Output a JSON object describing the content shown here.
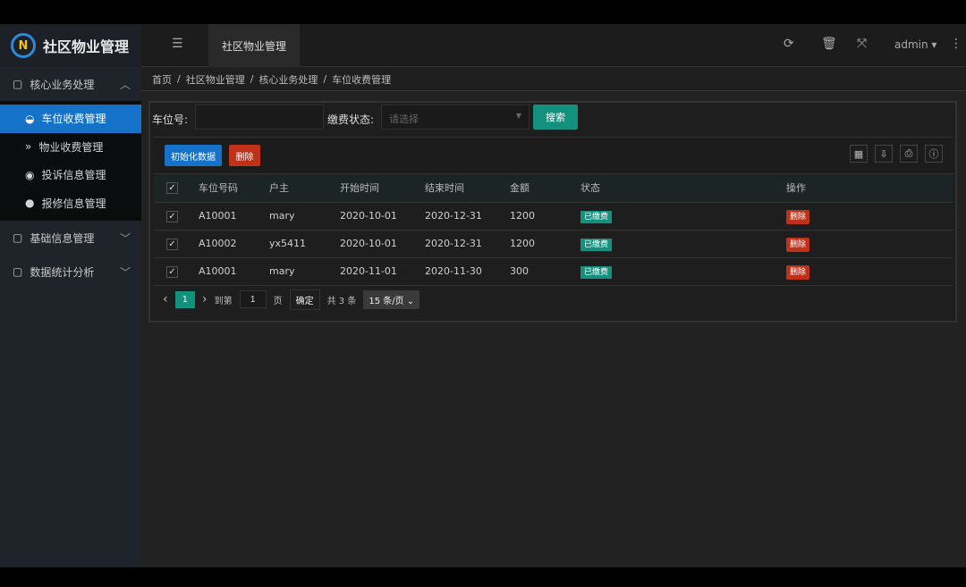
{
  "app": {
    "title": "社区物业管理",
    "logo_letter": "N",
    "tab": "社区物业管理",
    "user": "admin"
  },
  "header_icons": [
    "menu-icon",
    "refresh-icon",
    "trash-icon",
    "fullscreen-icon",
    "more-icon"
  ],
  "sidebar": {
    "groups": [
      {
        "label": "核心业务处理",
        "expanded": true,
        "items": [
          {
            "label": "车位收费管理",
            "active": true,
            "icon": "dashboard-icon"
          },
          {
            "label": "物业收费管理",
            "icon": "chevrons-down-icon"
          },
          {
            "label": "投诉信息管理",
            "icon": "target-icon"
          },
          {
            "label": "报修信息管理",
            "icon": "circle-icon"
          }
        ]
      },
      {
        "label": "基础信息管理",
        "expanded": false
      },
      {
        "label": "数据统计分析",
        "expanded": false
      }
    ]
  },
  "breadcrumb": [
    "首页",
    "社区物业管理",
    "核心业务处理",
    "车位收费管理"
  ],
  "search": {
    "plate_label": "车位号:",
    "plate_value": "",
    "status_label": "缴费状态:",
    "status_placeholder": "请选择",
    "search_button": "搜索"
  },
  "toolbar": {
    "init_button": "初始化数据",
    "delete_button": "删除"
  },
  "table": {
    "headers": [
      "车位号码",
      "户主",
      "开始时间",
      "结束时间",
      "金额",
      "状态",
      "操作"
    ],
    "rows": [
      {
        "plate": "A10001",
        "owner": "mary",
        "start": "2020-10-01",
        "end": "2020-12-31",
        "amount": "1200",
        "status": "已缴费",
        "action": "删除"
      },
      {
        "plate": "A10002",
        "owner": "yx5411",
        "start": "2020-10-01",
        "end": "2020-12-31",
        "amount": "1200",
        "status": "已缴费",
        "action": "删除"
      },
      {
        "plate": "A10001",
        "owner": "mary",
        "start": "2020-11-01",
        "end": "2020-11-30",
        "amount": "300",
        "status": "已缴费",
        "action": "删除"
      }
    ]
  },
  "pager": {
    "current": "1",
    "goto_label": "到第",
    "goto_value": "1",
    "page_label": "页",
    "confirm": "确定",
    "total": "共 3 条",
    "per_page": "15 条/页"
  },
  "colors": {
    "accent": "#1672c8",
    "teal": "#14907f",
    "danger": "#c0311a"
  }
}
